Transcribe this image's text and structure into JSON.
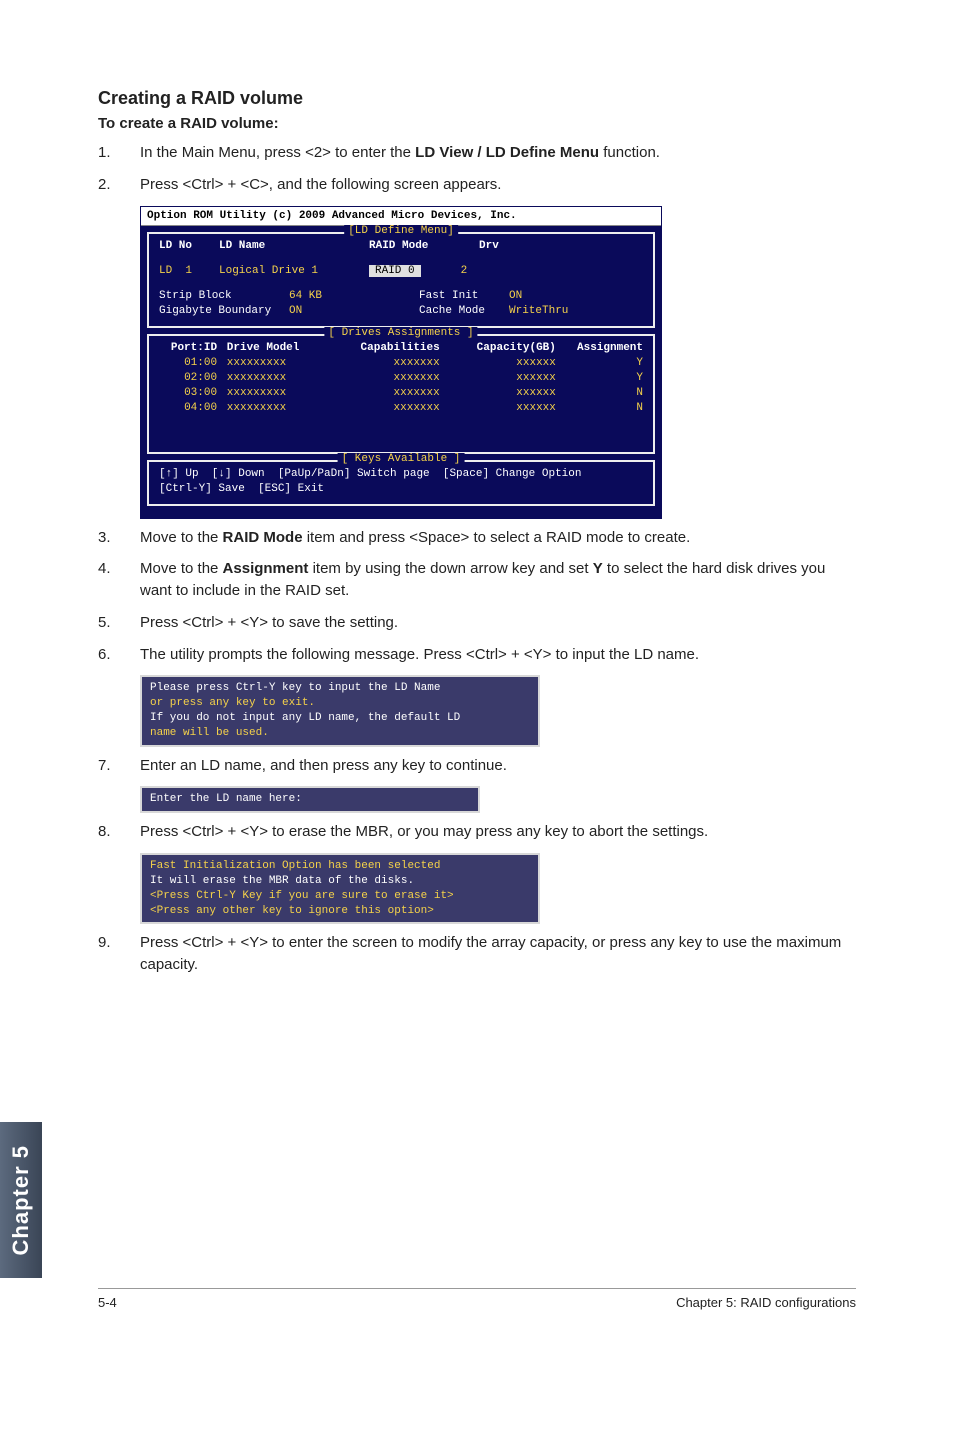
{
  "heading": "Creating a RAID volume",
  "subheading": "To create a RAID volume:",
  "steps": {
    "s1": {
      "n": "1.",
      "text_pre": "In the Main Menu, press <2> to enter the ",
      "bold": "LD View / LD Define Menu",
      "text_post": " function."
    },
    "s2": {
      "n": "2.",
      "text": "Press <Ctrl> + <C>, and the following screen appears."
    },
    "s3": {
      "n": "3.",
      "text_pre": "Move to the ",
      "bold": "RAID Mode",
      "text_post": " item and press <Space> to select a RAID mode to create."
    },
    "s4": {
      "n": "4.",
      "text_pre": "Move to the ",
      "bold": "Assignment",
      "text_mid": " item by using the down arrow key and set ",
      "bold2": "Y",
      "text_post": " to select the hard disk drives you want to include in the RAID set."
    },
    "s5": {
      "n": "5.",
      "text": "Press <Ctrl> + <Y> to save the setting."
    },
    "s6": {
      "n": "6.",
      "text": "The utility prompts the following message. Press <Ctrl> + <Y> to input the LD name."
    },
    "s7": {
      "n": "7.",
      "text": "Enter an LD name, and then press any key to continue."
    },
    "s8": {
      "n": "8.",
      "text": "Press <Ctrl> + <Y> to erase the MBR, or you may press any key to abort the settings."
    },
    "s9": {
      "n": "9.",
      "text": "Press <Ctrl> + <Y> to enter the screen to modify the array capacity, or press any key to use the maximum capacity."
    }
  },
  "bios": {
    "title": "Option ROM Utility (c) 2009 Advanced Micro Devices, Inc.",
    "ld_define_label": "[LD Define Menu]",
    "ldno": "LD No",
    "ldname": "LD Name",
    "raidmode": "RAID Mode",
    "drv": "Drv",
    "ldrow_ld": "LD  1",
    "ldrow_name": "Logical Drive 1",
    "ldrow_raid": "RAID 0",
    "ldrow_drv": "2",
    "strip_block_lbl": "Strip Block",
    "strip_block_val": "64 KB",
    "fastinit_lbl": "Fast Init",
    "fastinit_val": "ON",
    "gig_lbl": "Gigabyte Boundary",
    "gig_val": "ON",
    "cache_lbl": "Cache Mode",
    "cache_val": "WriteThru",
    "drives_label": "[ Drives Assignments ]",
    "col_pid": "Port:ID",
    "col_dm": "Drive Model",
    "col_cap": "Capabilities",
    "col_gb": "Capacity(GB)",
    "col_asg": "Assignment",
    "rows": [
      {
        "pid": "01:00",
        "dm": "xxxxxxxxx",
        "cap": "xxxxxxx",
        "gb": "xxxxxx",
        "asg": "Y"
      },
      {
        "pid": "02:00",
        "dm": "xxxxxxxxx",
        "cap": "xxxxxxx",
        "gb": "xxxxxx",
        "asg": "Y"
      },
      {
        "pid": "03:00",
        "dm": "xxxxxxxxx",
        "cap": "xxxxxxx",
        "gb": "xxxxxx",
        "asg": "N"
      },
      {
        "pid": "04:00",
        "dm": "xxxxxxxxx",
        "cap": "xxxxxxx",
        "gb": "xxxxxx",
        "asg": "N"
      }
    ],
    "keys_label": "[ Keys Available ]",
    "keys1": "[↑] Up  [↓] Down  [PaUp/PaDn] Switch page  [Space] Change Option",
    "keys2": "[Ctrl-Y] Save  [ESC] Exit"
  },
  "dlg_ldname": {
    "l1": "Please press Ctrl-Y key to input the LD Name",
    "l2": "or press any key to exit.",
    "l3": "If you do not input any LD name, the default LD",
    "l4": "name will be used."
  },
  "dlg_enter": {
    "l1": "Enter the LD name here:"
  },
  "dlg_mbr": {
    "l1": "Fast Initialization Option has been selected",
    "l2": "It will erase the MBR data of the disks.",
    "l3": "<Press Ctrl-Y Key if you are sure to erase it>",
    "l4": "<Press any other key to ignore this option>"
  },
  "chapter_tab": "Chapter 5",
  "footer_left": "5-4",
  "footer_right": "Chapter 5: RAID configurations"
}
